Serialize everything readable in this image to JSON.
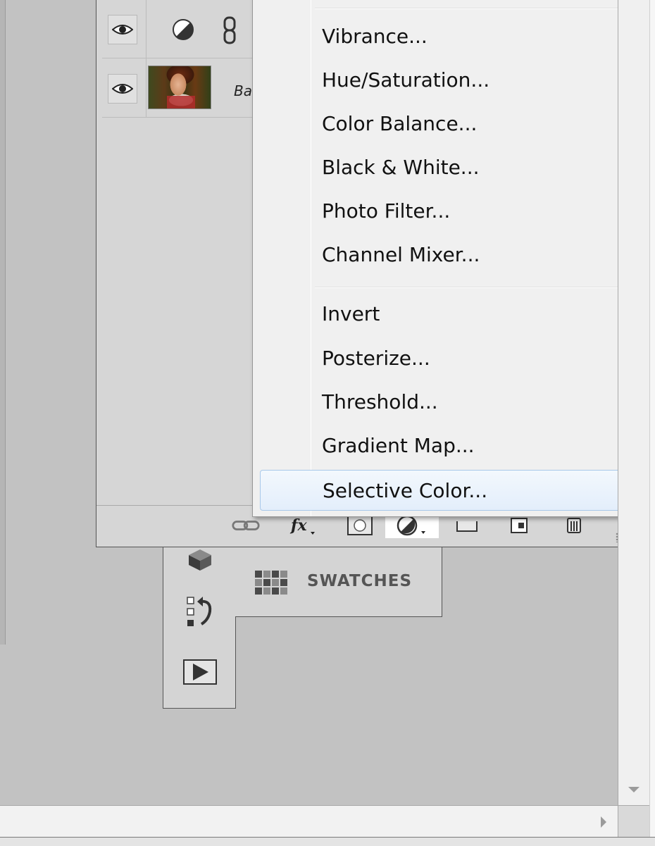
{
  "menu": {
    "group1": [
      "Vibrance...",
      "Hue/Saturation...",
      "Color Balance...",
      "Black & White...",
      "Photo Filter...",
      "Channel Mixer..."
    ],
    "group2": [
      "Invert",
      "Posterize...",
      "Threshold...",
      "Gradient Map...",
      "Selective Color..."
    ],
    "highlighted": "Selective Color..."
  },
  "layers_panel": {
    "layers": [
      {
        "type": "adjustment",
        "visible": true,
        "icon": "adjustment-circle-icon"
      },
      {
        "type": "image",
        "visible": true,
        "name_visible": "Ba"
      }
    ],
    "footer_icons": [
      "link-layers-icon",
      "fx-icon",
      "add-mask-icon",
      "new-adjustment-icon",
      "new-group-icon",
      "new-layer-icon",
      "trash-icon"
    ]
  },
  "dock": {
    "icons": [
      "3d-cube-icon",
      "history-icon",
      "actions-play-icon"
    ]
  },
  "swatches": {
    "label": "SWATCHES"
  },
  "colors": {
    "workspace": "#c2c2c2",
    "panel": "#d6d6d6",
    "menu_bg": "#f0f0f0",
    "menu_highlight_border": "#a8c8ea"
  }
}
